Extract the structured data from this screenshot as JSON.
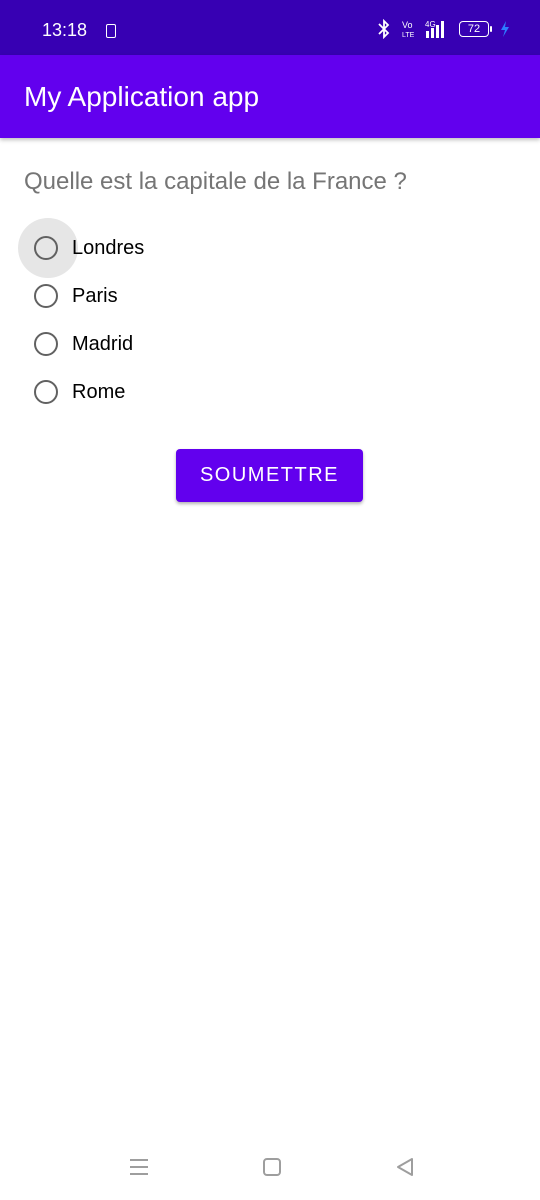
{
  "status_bar": {
    "time": "13:18",
    "network": "4G",
    "volte_label": "Vo LTE",
    "battery_level": "72",
    "icons": [
      "notification-icon",
      "bluetooth-icon",
      "volte-icon",
      "signal-icon",
      "battery-icon",
      "charging-icon"
    ]
  },
  "app_bar": {
    "title": "My Application app",
    "color": "#6200ee"
  },
  "quiz": {
    "question": "Quelle est la capitale de la France ?",
    "options": [
      "Londres",
      "Paris",
      "Madrid",
      "Rome"
    ],
    "focused_option_index": 0,
    "submit_label": "SOUMETTRE"
  },
  "nav_bar": {
    "icons": [
      "menu-icon",
      "home-icon",
      "back-icon"
    ]
  },
  "colors": {
    "status_bar": "#3700b3",
    "primary": "#6200ee",
    "question_text": "#757575"
  }
}
